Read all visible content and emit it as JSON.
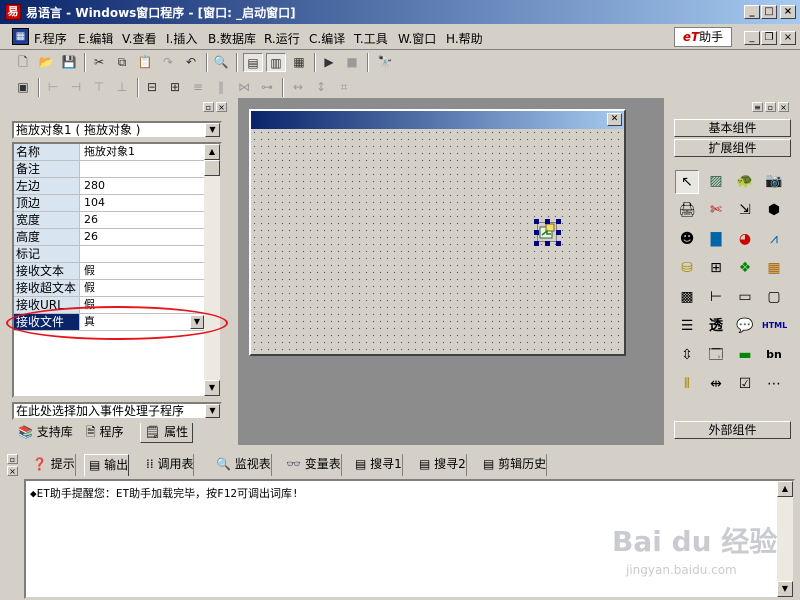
{
  "window": {
    "title": "易语言 - Windows窗口程序 - [窗口: _启动窗口]",
    "app_icon_glyph": "易",
    "min": "_",
    "max": "□",
    "close": "×"
  },
  "menu": {
    "items": [
      "F.程序",
      "E.编辑",
      "V.查看",
      "I.插入",
      "B.数据库",
      "R.运行",
      "C.编译",
      "T.工具",
      "W.窗口",
      "H.帮助"
    ],
    "et_helper": {
      "prefix": "eT",
      "label": "助手"
    }
  },
  "left_panel": {
    "object_selector": "拖放对象1 ( 拖放对象 )",
    "properties": [
      {
        "name": "名称",
        "value": "拖放对象1"
      },
      {
        "name": "备注",
        "value": ""
      },
      {
        "name": "左边",
        "value": "280"
      },
      {
        "name": "顶边",
        "value": "104"
      },
      {
        "name": "宽度",
        "value": "26"
      },
      {
        "name": "高度",
        "value": "26"
      },
      {
        "name": "标记",
        "value": ""
      },
      {
        "name": "接收文本",
        "value": "假"
      },
      {
        "name": "接收超文本",
        "value": "假"
      },
      {
        "name": "接收URL",
        "value": "假"
      },
      {
        "name": "接收文件",
        "value": "真"
      }
    ],
    "event_selector": "在此处选择加入事件处理子程序",
    "tabs": [
      "支持库",
      "程序",
      "属性"
    ]
  },
  "right_panel": {
    "basic_components": "基本组件",
    "extended_components": "扩展组件",
    "external_components": "外部组件",
    "tools": [
      "pointer-icon",
      "image-box-icon",
      "turtle-icon",
      "camera-icon",
      "print-preview-icon",
      "drag-drop-icon",
      "envelope-icon",
      "shapes-icon",
      "user-icon",
      "bar-chart-icon",
      "pie-chart-icon",
      "line-chart-icon",
      "database-icon",
      "table-icon",
      "tree-icon",
      "grid-icon",
      "calendar-icon",
      "tree-view-icon",
      "text-box-icon",
      "picture-frame-icon",
      "list-icon",
      "transparent-label-icon",
      "speech-bubble-icon",
      "html-icon",
      "scroll-icon",
      "window-icon",
      "progress-icon",
      "bn-icon",
      "slider-icon",
      "splitter-icon",
      "check-list-icon",
      "ellipsis-icon"
    ],
    "transparent_label_text": "透",
    "bn_text": "bn",
    "html_text": "HTML"
  },
  "bottom_panel": {
    "tabs": [
      "提示",
      "输出",
      "调用表",
      "监视表",
      "变量表",
      "搜寻1",
      "搜寻2",
      "剪辑历史"
    ],
    "active_tab": "输出",
    "output_line": "◆ET助手提醒您：ET助手加载完毕，按F12可调出词库!"
  },
  "watermark": {
    "main": "Bai du 经验",
    "sub": "jingyan.baidu.com"
  },
  "colors": {
    "titlebar": "#0a246a",
    "selection": "#0a246a",
    "highlight_oval": "#e8141c",
    "property_name_bg": "#d8e4f0"
  }
}
